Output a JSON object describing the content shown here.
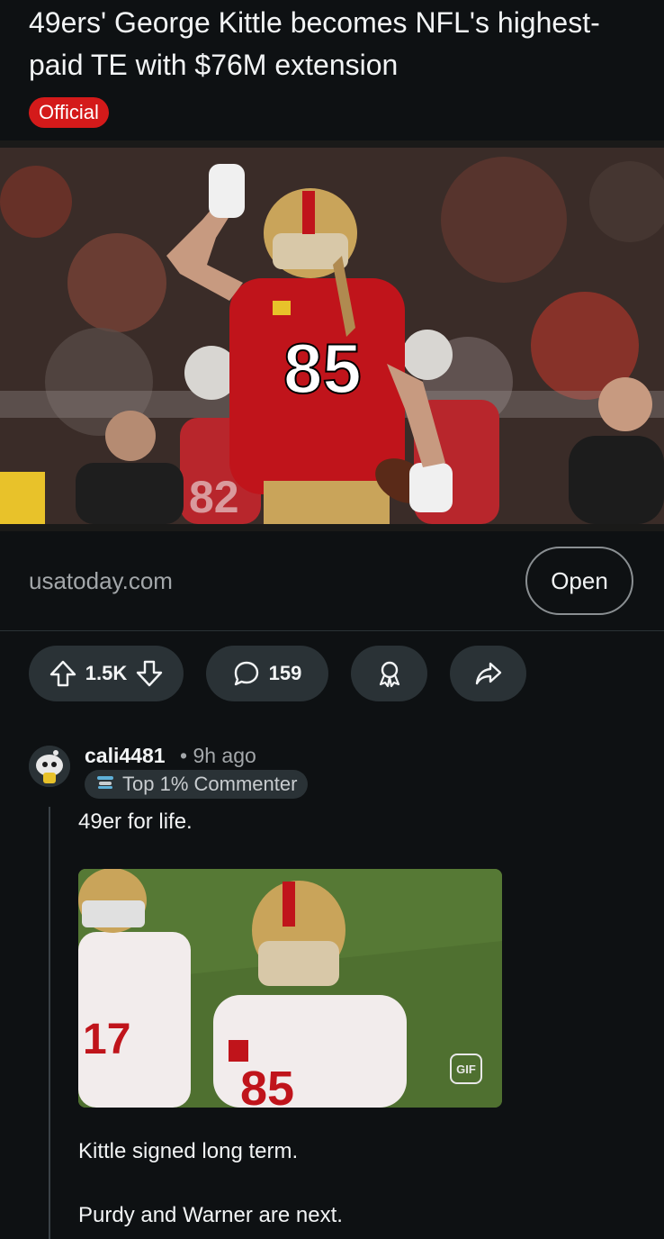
{
  "post": {
    "title": "49ers' George Kittle becomes NFL's highest-paid TE with $76M extension",
    "flair": "Official",
    "flair_color": "#d41a1a",
    "image_alt": "George Kittle #85 celebrating on field",
    "jersey_number": "85",
    "source": "usatoday.com",
    "open_label": "Open"
  },
  "actions": {
    "upvotes": "1.5K",
    "comments": "159"
  },
  "comment": {
    "username": "cali4481",
    "time": "• 9h ago",
    "badge": "Top 1% Commenter",
    "text1": "49er for life.",
    "gif_label": "GIF",
    "gif_jersey_left": "17",
    "gif_jersey_center": "85",
    "text2": "Kittle signed long term.",
    "text3": "Purdy and Warner are next."
  },
  "colors": {
    "background": "#0e1113",
    "pill": "#2a3236",
    "team_red": "#c0141b",
    "gold": "#c9a45a"
  }
}
